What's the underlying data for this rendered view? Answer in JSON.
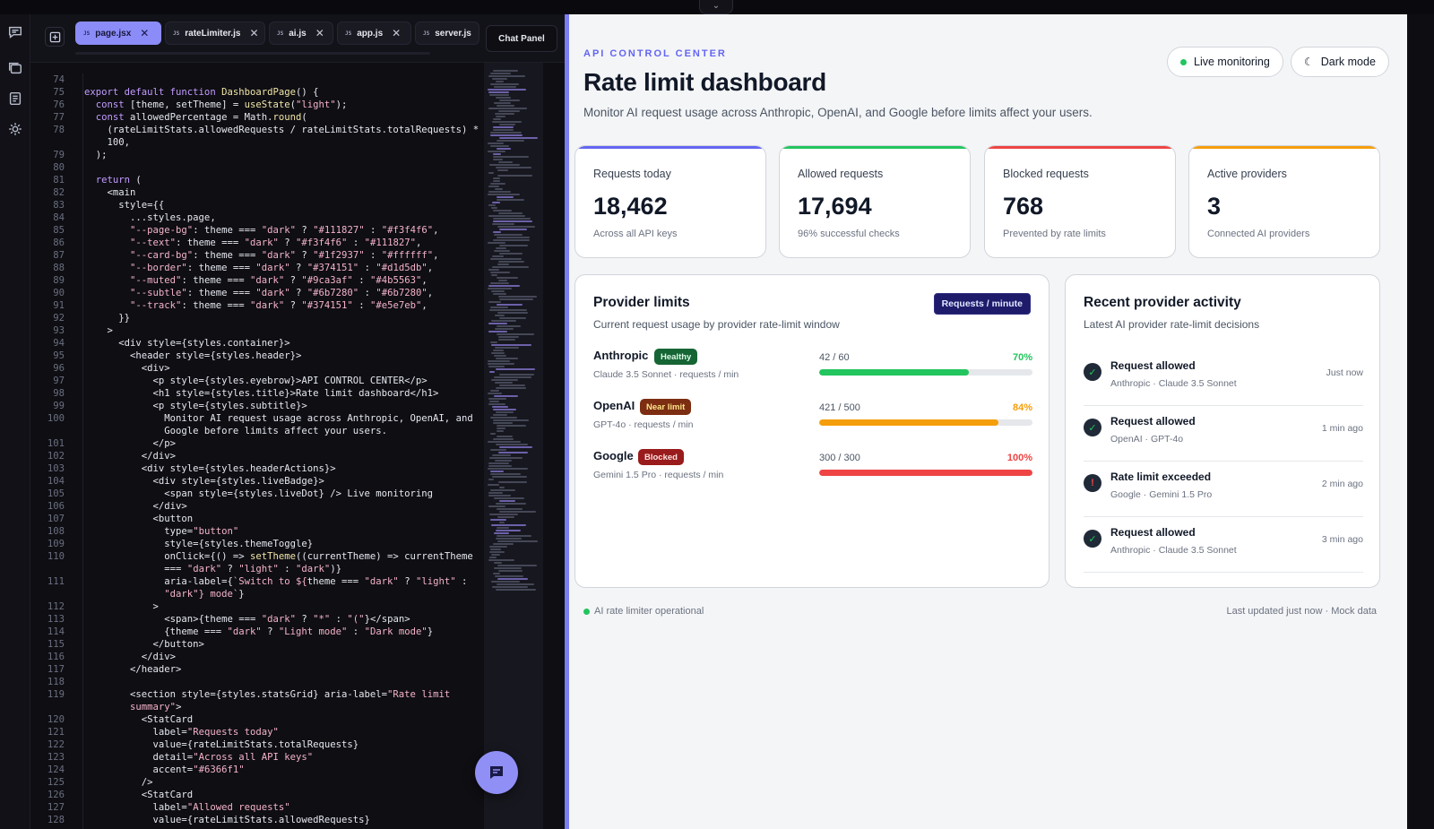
{
  "editor": {
    "tabs": [
      {
        "label": "page.jsx",
        "active": true
      },
      {
        "label": "rateLimiter.js",
        "active": false
      },
      {
        "label": "ai.js",
        "active": false
      },
      {
        "label": "app.js",
        "active": false
      },
      {
        "label": "server.js",
        "active": false
      }
    ],
    "tab_icon_text": "JS",
    "chat_panel_label": "Chat Panel",
    "code_lines": [
      {
        "n": "74",
        "t": ""
      },
      {
        "n": "75",
        "t": "<span class=\"k\">export default function</span> <span class=\"f\">DashboardPage</span>() {"
      },
      {
        "n": "76",
        "t": "  <span class=\"k\">const</span> [theme, setTheme] = <span class=\"f\">useState</span>(<span class=\"s\">\"light\"</span>);"
      },
      {
        "n": "77",
        "t": "  <span class=\"k\">const</span> allowedPercentage = Math.<span class=\"f\">round</span>("
      },
      {
        "n": "78",
        "t": "    (rateLimitStats.allowedRequests / rateLimitStats.totalRequests) *"
      },
      {
        "n": "",
        "t": "    100,"
      },
      {
        "n": "79",
        "t": "  );"
      },
      {
        "n": "80",
        "t": ""
      },
      {
        "n": "81",
        "t": "  <span class=\"k\">return</span> ("
      },
      {
        "n": "82",
        "t": "    &lt;main"
      },
      {
        "n": "83",
        "t": "      style={{"
      },
      {
        "n": "84",
        "t": "        ...styles.page,"
      },
      {
        "n": "85",
        "t": "        <span class=\"s\">\"--page-bg\"</span>: theme === <span class=\"s\">\"dark\"</span> ? <span class=\"s\">\"#111827\"</span> : <span class=\"s\">\"#f3f4f6\"</span>,"
      },
      {
        "n": "86",
        "t": "        <span class=\"s\">\"--text\"</span>: theme === <span class=\"s\">\"dark\"</span> ? <span class=\"s\">\"#f3f4f6\"</span> : <span class=\"s\">\"#111827\"</span>,"
      },
      {
        "n": "87",
        "t": "        <span class=\"s\">\"--card-bg\"</span>: theme === <span class=\"s\">\"dark\"</span> ? <span class=\"s\">\"#1f2937\"</span> : <span class=\"s\">\"#ffffff\"</span>,"
      },
      {
        "n": "88",
        "t": "        <span class=\"s\">\"--border\"</span>: theme === <span class=\"s\">\"dark\"</span> ? <span class=\"s\">\"#374151\"</span> : <span class=\"s\">\"#d1d5db\"</span>,"
      },
      {
        "n": "89",
        "t": "        <span class=\"s\">\"--muted\"</span>: theme === <span class=\"s\">\"dark\"</span> ? <span class=\"s\">\"#9ca3af\"</span> : <span class=\"s\">\"#4b5563\"</span>,"
      },
      {
        "n": "90",
        "t": "        <span class=\"s\">\"--subtle\"</span>: theme === <span class=\"s\">\"dark\"</span> ? <span class=\"s\">\"#6b7280\"</span> : <span class=\"s\">\"#6b7280\"</span>,"
      },
      {
        "n": "91",
        "t": "        <span class=\"s\">\"--track\"</span>: theme === <span class=\"s\">\"dark\"</span> ? <span class=\"s\">\"#374151\"</span> : <span class=\"s\">\"#e5e7eb\"</span>,"
      },
      {
        "n": "92",
        "t": "      }}"
      },
      {
        "n": "93",
        "t": "    &gt;"
      },
      {
        "n": "94",
        "t": "      &lt;div style={styles.container}&gt;"
      },
      {
        "n": "95",
        "t": "        &lt;header style={styles.header}&gt;"
      },
      {
        "n": "96",
        "t": "          &lt;div&gt;"
      },
      {
        "n": "97",
        "t": "            &lt;p style={styles.eyebrow}&gt;API CONTROL CENTER&lt;/p&gt;"
      },
      {
        "n": "98",
        "t": "            &lt;h1 style={styles.title}&gt;Rate limit dashboard&lt;/h1&gt;"
      },
      {
        "n": "99",
        "t": "            &lt;p style={styles.subtitle}&gt;"
      },
      {
        "n": "100",
        "t": "              Monitor AI request usage across Anthropic, OpenAI, and"
      },
      {
        "n": "",
        "t": "              Google before limits affect your users."
      },
      {
        "n": "101",
        "t": "            &lt;/p&gt;"
      },
      {
        "n": "102",
        "t": "          &lt;/div&gt;"
      },
      {
        "n": "103",
        "t": "          &lt;div style={styles.headerActions}&gt;"
      },
      {
        "n": "104",
        "t": "            &lt;div style={styles.liveBadge}&gt;"
      },
      {
        "n": "105",
        "t": "              &lt;span style={styles.liveDot} /&gt; Live monitoring"
      },
      {
        "n": "106",
        "t": "            &lt;/div&gt;"
      },
      {
        "n": "107",
        "t": "            &lt;button"
      },
      {
        "n": "108",
        "t": "              type=<span class=\"s\">\"button\"</span>"
      },
      {
        "n": "109",
        "t": "              style={styles.themeToggle}"
      },
      {
        "n": "110",
        "t": "              onClick={() =&gt; <span class=\"f\">setTheme</span>((currentTheme) =&gt; currentTheme"
      },
      {
        "n": "",
        "t": "              === <span class=\"s\">\"dark\"</span> ? <span class=\"s\">\"light\"</span> : <span class=\"s\">\"dark\"</span>)}"
      },
      {
        "n": "111",
        "t": "              aria-label={<span class=\"s\">`Switch to ${</span>theme === <span class=\"s\">\"dark\"</span> ? <span class=\"s\">\"light\"</span> :"
      },
      {
        "n": "",
        "t": "              <span class=\"s\">\"dark\"</span><span class=\"s\">} mode`</span>}"
      },
      {
        "n": "112",
        "t": "            &gt;"
      },
      {
        "n": "113",
        "t": "              &lt;span&gt;{theme === <span class=\"s\">\"dark\"</span> ? <span class=\"s\">\"*\"</span> : <span class=\"s\">\"(\"</span>}&lt;/span&gt;"
      },
      {
        "n": "114",
        "t": "              {theme === <span class=\"s\">\"dark\"</span> ? <span class=\"s\">\"Light mode\"</span> : <span class=\"s\">\"Dark mode\"</span>}"
      },
      {
        "n": "115",
        "t": "            &lt;/button&gt;"
      },
      {
        "n": "116",
        "t": "          &lt;/div&gt;"
      },
      {
        "n": "117",
        "t": "        &lt;/header&gt;"
      },
      {
        "n": "118",
        "t": ""
      },
      {
        "n": "119",
        "t": "        &lt;section style={styles.statsGrid} aria-label=<span class=\"s\">\"Rate limit</span>"
      },
      {
        "n": "",
        "t": "        <span class=\"s\">summary\"</span>&gt;"
      },
      {
        "n": "120",
        "t": "          &lt;StatCard"
      },
      {
        "n": "121",
        "t": "            label=<span class=\"s\">\"Requests today\"</span>"
      },
      {
        "n": "122",
        "t": "            value={rateLimitStats.totalRequests}"
      },
      {
        "n": "123",
        "t": "            detail=<span class=\"s\">\"Across all API keys\"</span>"
      },
      {
        "n": "124",
        "t": "            accent=<span class=\"s\">\"#6366f1\"</span>"
      },
      {
        "n": "125",
        "t": "          /&gt;"
      },
      {
        "n": "126",
        "t": "          &lt;StatCard"
      },
      {
        "n": "127",
        "t": "            label=<span class=\"s\">\"Allowed requests\"</span>"
      },
      {
        "n": "128",
        "t": "            value={rateLimitStats.allowedRequests}"
      }
    ]
  },
  "dashboard": {
    "eyebrow": "API CONTROL CENTER",
    "title": "Rate limit dashboard",
    "subtitle": "Monitor AI request usage across Anthropic, OpenAI, and Google before limits affect your users.",
    "live_label": "Live monitoring",
    "theme_label": "Dark mode",
    "stats": [
      {
        "label": "Requests today",
        "value": "18,462",
        "detail": "Across all API keys",
        "accent": "#6366f1"
      },
      {
        "label": "Allowed requests",
        "value": "17,694",
        "detail": "96% successful checks",
        "accent": "#22c55e"
      },
      {
        "label": "Blocked requests",
        "value": "768",
        "detail": "Prevented by rate limits",
        "accent": "#ef4444"
      },
      {
        "label": "Active providers",
        "value": "3",
        "detail": "Connected AI providers",
        "accent": "#f59e0b"
      }
    ],
    "limits": {
      "title": "Provider limits",
      "subtitle": "Current request usage by provider rate-limit window",
      "badge": "Requests / minute",
      "providers": [
        {
          "name": "Anthropic",
          "status": "Healthy",
          "status_bg": "#166534",
          "status_fg": "#dcfce7",
          "model": "Claude 3.5 Sonnet · requests / min",
          "count": "42 / 60",
          "pct": "70%",
          "fraction": 0.7,
          "color": "#22c55e"
        },
        {
          "name": "OpenAI",
          "status": "Near limit",
          "status_bg": "#7c2d12",
          "status_fg": "#fde68a",
          "model": "GPT-4o · requests / min",
          "count": "421 / 500",
          "pct": "84%",
          "fraction": 0.84,
          "color": "#f59e0b"
        },
        {
          "name": "Google",
          "status": "Blocked",
          "status_bg": "#991b1b",
          "status_fg": "#fee2e2",
          "model": "Gemini 1.5 Pro · requests / min",
          "count": "300 / 300",
          "pct": "100%",
          "fraction": 1.0,
          "color": "#ef4444"
        }
      ]
    },
    "activity": {
      "title": "Recent provider activity",
      "subtitle": "Latest AI provider rate-limit decisions",
      "items": [
        {
          "title": "Request allowed",
          "meta": "Anthropic · Claude 3.5 Sonnet",
          "time": "Just now",
          "icon": "check-icon",
          "color": "#22c55e"
        },
        {
          "title": "Request allowed",
          "meta": "OpenAI · GPT-4o",
          "time": "1 min ago",
          "icon": "check-icon",
          "color": "#22c55e"
        },
        {
          "title": "Rate limit exceeded",
          "meta": "Google · Gemini 1.5 Pro",
          "time": "2 min ago",
          "icon": "alert-icon",
          "color": "#ef4444"
        },
        {
          "title": "Request allowed",
          "meta": "Anthropic · Claude 3.5 Sonnet",
          "time": "3 min ago",
          "icon": "check-icon",
          "color": "#22c55e"
        }
      ]
    },
    "footer_left": "AI rate limiter operational",
    "footer_right": "Last updated just now · Mock data"
  }
}
